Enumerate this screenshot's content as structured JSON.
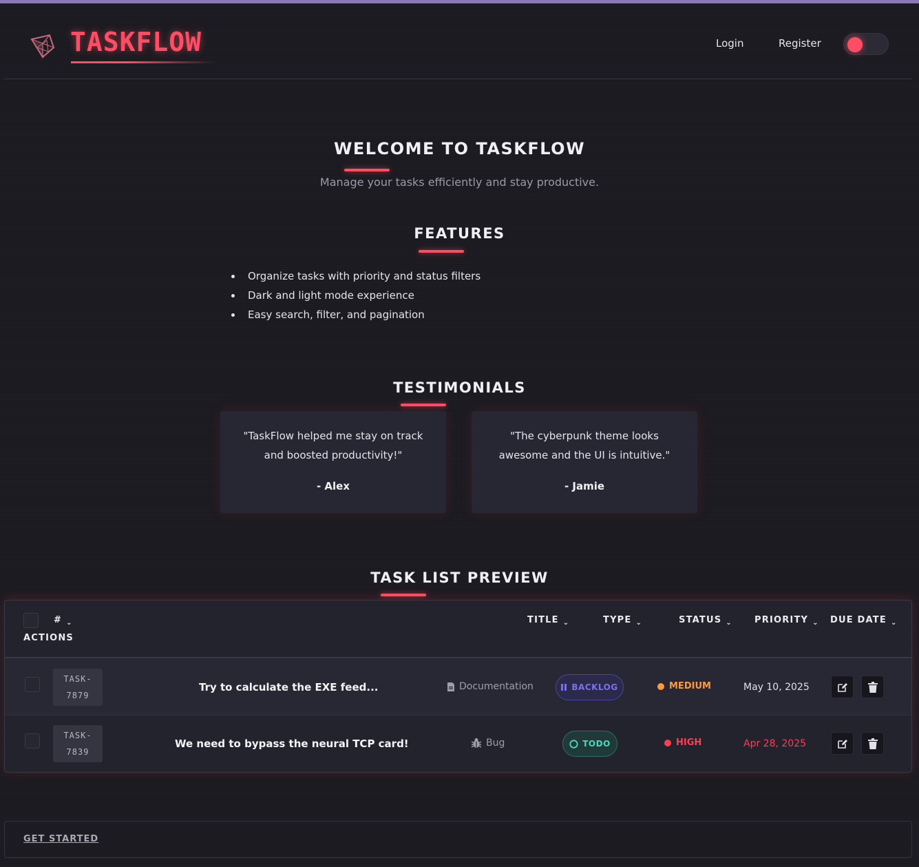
{
  "app": {
    "name": "TASKFLOW"
  },
  "header": {
    "login_label": "Login",
    "register_label": "Register"
  },
  "hero": {
    "title": "WELCOME TO TASKFLOW",
    "subtitle": "Manage your tasks efficiently and stay productive."
  },
  "features": {
    "title": "FEATURES",
    "items": [
      "Organize tasks with priority and status filters",
      "Dark and light mode experience",
      "Easy search, filter, and pagination"
    ]
  },
  "testimonials": {
    "title": "TESTIMONIALS",
    "items": [
      {
        "quote": "\"TaskFlow helped me stay on track and boosted productivity!\"",
        "author": "- Alex"
      },
      {
        "quote": "\"The cyberpunk theme looks awesome and the UI is intuitive.\"",
        "author": "- Jamie"
      }
    ]
  },
  "task_preview": {
    "title": "TASK LIST PREVIEW",
    "columns": {
      "id": "#",
      "title": "TITLE",
      "type": "TYPE",
      "status": "STATUS",
      "priority": "PRIORITY",
      "due_date": "DUE DATE",
      "actions": "ACTIONS"
    },
    "rows": [
      {
        "id_prefix": "TASK-",
        "id_number": "7879",
        "title": "Try to calculate the EXE feed...",
        "type": "Documentation",
        "status": "BACKLOG",
        "priority": "MEDIUM",
        "due_date": "May 10, 2025"
      },
      {
        "id_prefix": "TASK-",
        "id_number": "7839",
        "title": "We need to bypass the neural TCP card!",
        "type": "Bug",
        "status": "TODO",
        "priority": "HIGH",
        "due_date": "Apr 28, 2025"
      }
    ]
  },
  "footer": {
    "cta_label": "GET STARTED"
  },
  "colors": {
    "accent": "#ff4d63",
    "background": "#1b1a20",
    "card": "#23232d",
    "backlog": "#7a6ff0",
    "todo": "#4fd6bf",
    "medium": "#ff9a3c",
    "high": "#ff3d55"
  },
  "icons": {
    "logo": "geometric-gem-icon",
    "documentation": "document-icon",
    "bug": "bug-icon",
    "backlog": "pause-icon",
    "todo": "circle-icon",
    "edit": "edit-icon",
    "delete": "trash-icon",
    "sort": "chevron-down-icon"
  }
}
